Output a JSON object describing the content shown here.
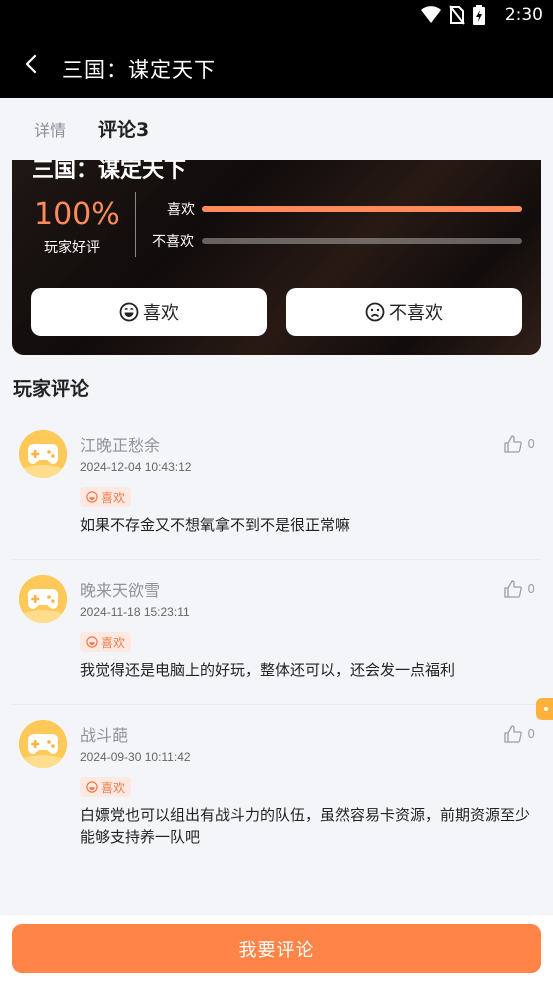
{
  "status_bar": {
    "time": "2:30"
  },
  "app_bar": {
    "title": "三国：谋定天下"
  },
  "tabs": {
    "details": "详情",
    "comments": "评论3"
  },
  "rating": {
    "game_title": "三国：谋定天下",
    "percent": "100%",
    "percent_label": "玩家好评",
    "like_label": "喜欢",
    "dislike_label": "不喜欢",
    "like_ratio": 1.0,
    "dislike_ratio": 0.0,
    "like_button": "喜欢",
    "dislike_button": "不喜欢"
  },
  "section_title": "玩家评论",
  "comments": [
    {
      "name": "江晚正愁余",
      "time": "2024-12-04 10:43:12",
      "badge": "喜欢",
      "text": "如果不存金又不想氧拿不到不是很正常嘛",
      "likes": "0"
    },
    {
      "name": "晚来天欲雪",
      "time": "2024-11-18 15:23:11",
      "badge": "喜欢",
      "text": "我觉得还是电脑上的好玩，整体还可以，还会发一点福利",
      "likes": "0"
    },
    {
      "name": "战斗葩",
      "time": "2024-09-30 10:11:42",
      "badge": "喜欢",
      "text": "白嫖党也可以组出有战斗力的队伍，虽然容易卡资源，前期资源至少能够支持养一队吧",
      "likes": "0"
    }
  ],
  "footer": {
    "button": "我要评论"
  },
  "colors": {
    "accent": "#ff8447",
    "badge_bg": "#fde9e1",
    "bar_fill": "#ff8a5b"
  }
}
